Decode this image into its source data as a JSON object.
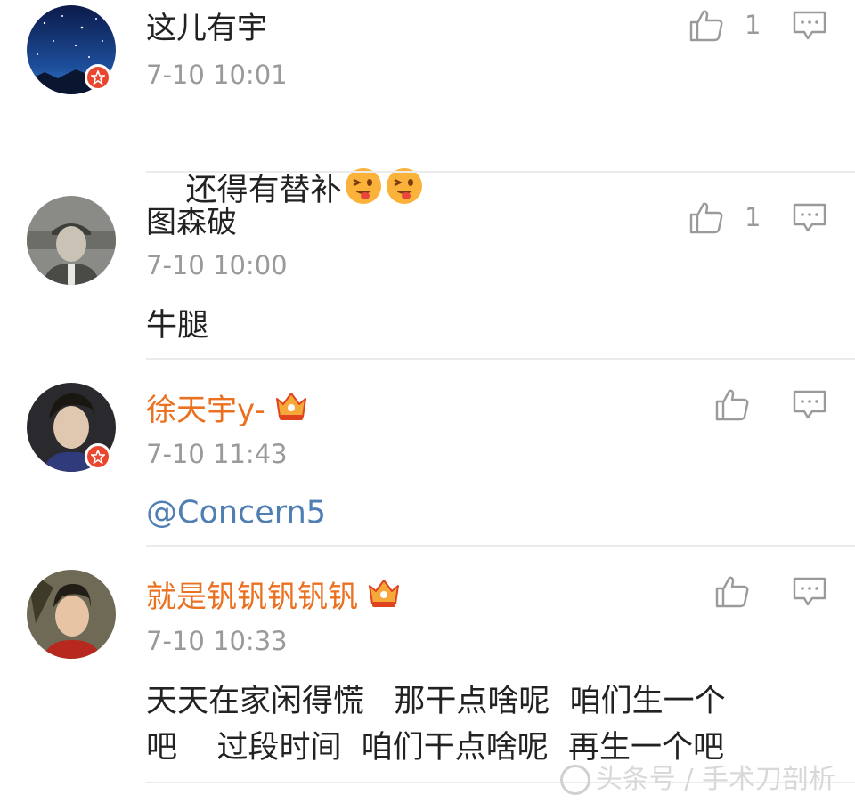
{
  "comments": [
    {
      "username": "这儿有宇",
      "username_color": "#222222",
      "time": "7-10 10:01",
      "text": "还得有替补",
      "emoji_count": 2,
      "likes": "1",
      "verified": true,
      "crown": false,
      "avatar": "starry-night-avatar"
    },
    {
      "username": "图森破",
      "username_color": "#222222",
      "time": "7-10 10:00",
      "text": "牛腿",
      "likes": "1",
      "verified": false,
      "crown": false,
      "avatar": "old-man-avatar"
    },
    {
      "username": "徐天宇y-",
      "username_color": "#eb7020",
      "time": "7-10 11:43",
      "text": "@Concern5",
      "likes": "",
      "verified": true,
      "crown": true,
      "avatar": "young-man-avatar"
    },
    {
      "username": "就是钒钒钒钒钒",
      "username_color": "#eb7020",
      "time": "7-10 10:33",
      "text_line1": "天天在家闲得慌   那干点啥呢  咱们生一个",
      "text_line2": "吧    过段时间  咱们干点啥呢  再生一个吧",
      "likes": "",
      "verified": false,
      "crown": true,
      "avatar": "young-man-red-avatar"
    }
  ],
  "watermark": "头条号 / 手术刀剖析",
  "colors": {
    "accent_orange": "#eb7020",
    "mention_blue": "#4f7eb3",
    "time_gray": "#9a9a9a",
    "badge_red": "#e8462e"
  },
  "icons": [
    "thumbs-up-icon",
    "reply-icon",
    "verified-badge-icon",
    "crown-icon",
    "tongue-out-emoji"
  ]
}
